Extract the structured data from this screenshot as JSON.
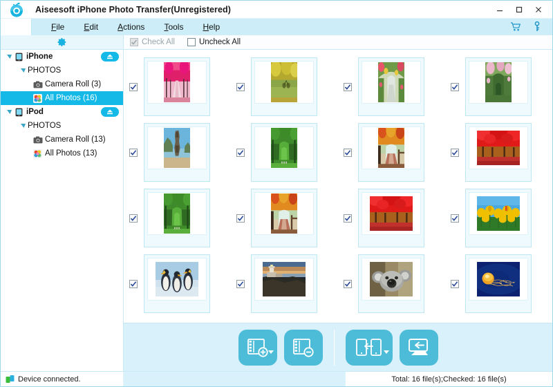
{
  "window": {
    "title": "Aiseesoft iPhone Photo Transfer(Unregistered)",
    "logo_icon": "app-camera-logo-icon",
    "controls": {
      "minimize_icon": "minimize-icon",
      "maximize_icon": "maximize-icon",
      "close_icon": "close-icon"
    }
  },
  "menubar": {
    "items": [
      {
        "label": "File",
        "accesskey": "F",
        "rest": "ile"
      },
      {
        "label": "Edit",
        "accesskey": "E",
        "rest": "dit"
      },
      {
        "label": "Actions",
        "accesskey": "A",
        "rest": "ctions"
      },
      {
        "label": "Tools",
        "accesskey": "T",
        "rest": "ools"
      },
      {
        "label": "Help",
        "accesskey": "H",
        "rest": "elp"
      }
    ],
    "right_icons": [
      {
        "name": "shopping-cart-icon"
      },
      {
        "name": "registration-key-icon"
      }
    ]
  },
  "toolstrip": {
    "settings_icon": "gear-icon",
    "check_all": {
      "label": "Check All",
      "checked": true,
      "enabled": false
    },
    "uncheck_all": {
      "label": "Uncheck All",
      "checked": false,
      "enabled": true
    }
  },
  "sidebar": {
    "nodes": [
      {
        "label": "iPhone",
        "level": 0,
        "type": "device",
        "icon": "phone-icon",
        "expanded": true,
        "selected": false,
        "eject": true
      },
      {
        "label": "PHOTOS",
        "level": 1,
        "type": "group",
        "icon": "",
        "expanded": true,
        "selected": false,
        "eject": false
      },
      {
        "label": "Camera Roll (3)",
        "level": 2,
        "type": "album",
        "icon": "camera-icon",
        "expanded": false,
        "selected": false,
        "eject": false
      },
      {
        "label": "All Photos (16)",
        "level": 2,
        "type": "album",
        "icon": "photos-icon",
        "expanded": false,
        "selected": true,
        "eject": false
      },
      {
        "label": "iPod",
        "level": 0,
        "type": "device",
        "icon": "phone-icon",
        "expanded": true,
        "selected": false,
        "eject": true
      },
      {
        "label": "PHOTOS",
        "level": 1,
        "type": "group",
        "icon": "",
        "expanded": true,
        "selected": false,
        "eject": false
      },
      {
        "label": "Camera Roll (13)",
        "level": 2,
        "type": "album",
        "icon": "camera-icon",
        "expanded": false,
        "selected": false,
        "eject": false
      },
      {
        "label": "All Photos (13)",
        "level": 2,
        "type": "album",
        "icon": "photos-icon",
        "expanded": false,
        "selected": false,
        "eject": false
      }
    ],
    "eject_icon": "eject-icon"
  },
  "photos": [
    {
      "id": 1,
      "name": "pink-blossom-avenue",
      "checked": true,
      "orientation": "portrait",
      "theme": "pink-tree-path"
    },
    {
      "id": 2,
      "name": "bicycle-autumn-park",
      "checked": true,
      "orientation": "portrait",
      "theme": "yellow-park"
    },
    {
      "id": 3,
      "name": "flower-archway-path",
      "checked": true,
      "orientation": "portrait",
      "theme": "garden-arch"
    },
    {
      "id": 4,
      "name": "rose-garden-arch",
      "checked": true,
      "orientation": "portrait",
      "theme": "green-arch"
    },
    {
      "id": 5,
      "name": "island-rock-formation",
      "checked": true,
      "orientation": "portrait",
      "theme": "rock-sea"
    },
    {
      "id": 6,
      "name": "green-tree-tunnel",
      "checked": true,
      "orientation": "portrait",
      "theme": "green-tunnel"
    },
    {
      "id": 7,
      "name": "autumn-boardwalk",
      "checked": true,
      "orientation": "portrait",
      "theme": "autumn-path"
    },
    {
      "id": 8,
      "name": "red-maple-forest",
      "checked": true,
      "orientation": "landscape",
      "theme": "red-maple"
    },
    {
      "id": 9,
      "name": "green-tree-tunnel-2",
      "checked": true,
      "orientation": "portrait",
      "theme": "green-tunnel"
    },
    {
      "id": 10,
      "name": "autumn-boardwalk-2",
      "checked": true,
      "orientation": "portrait",
      "theme": "autumn-path"
    },
    {
      "id": 11,
      "name": "red-maple-forest-2",
      "checked": true,
      "orientation": "landscape",
      "theme": "red-maple"
    },
    {
      "id": 12,
      "name": "yellow-tulips",
      "checked": true,
      "orientation": "landscape",
      "theme": "tulips"
    },
    {
      "id": 13,
      "name": "penguins",
      "checked": true,
      "orientation": "landscape",
      "theme": "penguins"
    },
    {
      "id": 14,
      "name": "lighthouse-sunset",
      "checked": true,
      "orientation": "landscape",
      "theme": "lighthouse"
    },
    {
      "id": 15,
      "name": "koala",
      "checked": true,
      "orientation": "landscape",
      "theme": "koala"
    },
    {
      "id": 16,
      "name": "jellyfish",
      "checked": true,
      "orientation": "landscape",
      "theme": "jellyfish"
    }
  ],
  "actionbar": {
    "buttons": [
      {
        "name": "add-photo-button",
        "icon": "film-plus-icon",
        "has_dropdown": true
      },
      {
        "name": "remove-photo-button",
        "icon": "film-minus-icon",
        "has_dropdown": false
      },
      {
        "name": "device-transfer-button",
        "icon": "device-to-device-icon",
        "has_dropdown": true
      },
      {
        "name": "export-to-pc-button",
        "icon": "export-to-pc-icon",
        "has_dropdown": false
      }
    ]
  },
  "statusbar": {
    "connection_icon": "device-connected-icon",
    "connection_text": "Device connected.",
    "counts_text": "Total: 16 file(s);Checked: 16 file(s)"
  },
  "colors": {
    "accent": "#14b9e8",
    "menu_bg": "#cdeef8",
    "panel_bg": "#d8f1fa",
    "button_fill": "#4cbcd8",
    "frame_border": "#bfe6f3"
  }
}
